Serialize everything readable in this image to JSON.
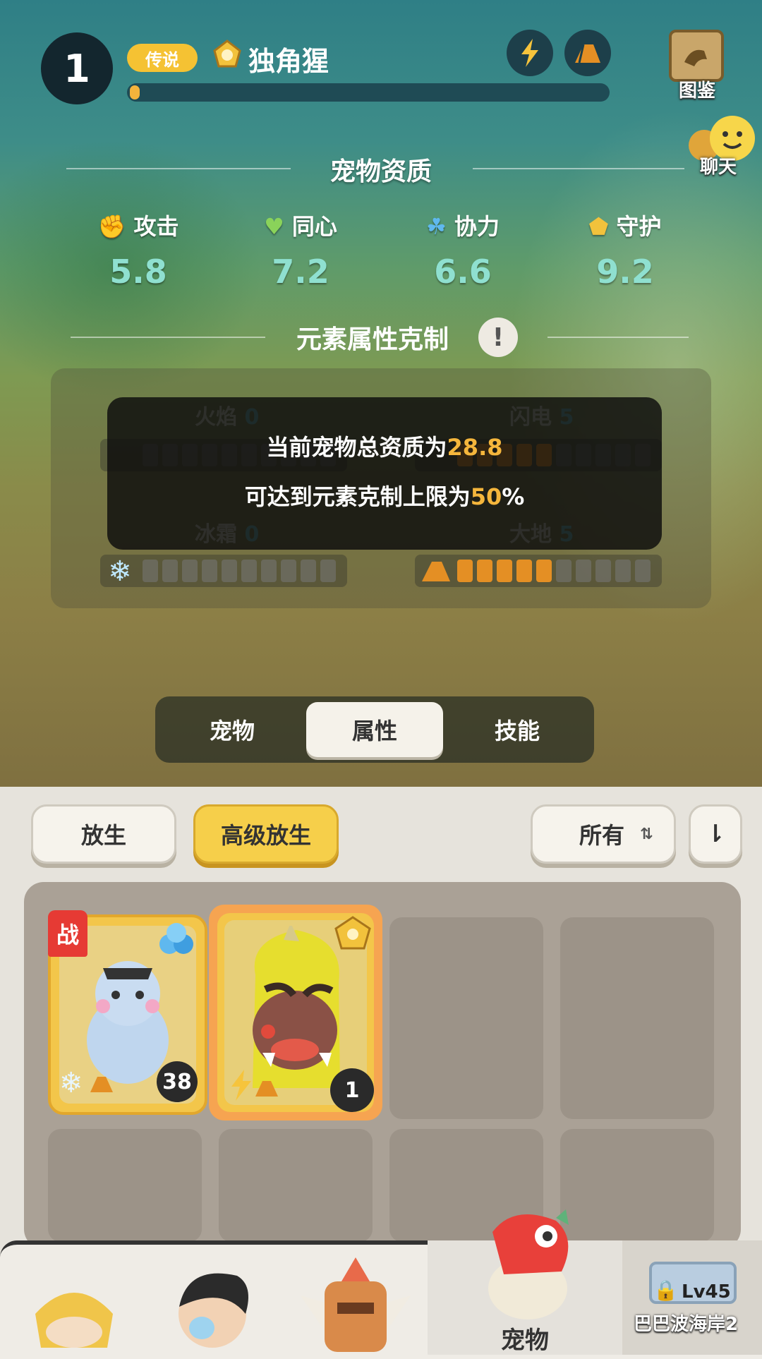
{
  "header": {
    "level": "1",
    "rarity": "传说",
    "pet_name": "独角猩",
    "xp_progress": 0.02,
    "codex_label": "图鉴",
    "chat_label": "聊天"
  },
  "aptitude": {
    "title": "宠物资质",
    "stats": [
      {
        "name": "攻击",
        "value": "5.8",
        "icon": "attack-icon"
      },
      {
        "name": "同心",
        "value": "7.2",
        "icon": "heart-icon"
      },
      {
        "name": "协力",
        "value": "6.6",
        "icon": "teamwork-icon"
      },
      {
        "name": "守护",
        "value": "9.2",
        "icon": "guard-icon"
      }
    ]
  },
  "element": {
    "title": "元素属性克制",
    "items": [
      {
        "name": "火焰",
        "value": "0",
        "filled": 0,
        "total": 10,
        "icon": "fire-icon"
      },
      {
        "name": "闪电",
        "value": "5",
        "filled": 5,
        "total": 10,
        "icon": "lightning-icon"
      },
      {
        "name": "冰霜",
        "value": "0",
        "filled": 0,
        "total": 10,
        "icon": "snowflake-icon"
      },
      {
        "name": "大地",
        "value": "5",
        "filled": 5,
        "total": 10,
        "icon": "earth-icon"
      }
    ]
  },
  "tooltip": {
    "line1_prefix": "当前宠物总资质为",
    "line1_value": "28.8",
    "line2_prefix": "可达到元素克制上限为",
    "line2_value": "50",
    "line2_suffix": "%"
  },
  "tabs": {
    "items": [
      "宠物",
      "属性",
      "技能"
    ],
    "active": "属性"
  },
  "actions": {
    "release": "放生",
    "advanced_release": "高级放生",
    "filter": "所有"
  },
  "pets": [
    {
      "level": "38",
      "battle_tag": "战",
      "name_hidden": true
    },
    {
      "level": "1"
    }
  ],
  "bottom_nav": {
    "pet_label": "宠物",
    "locked_level": "Lv45",
    "locked_area": "巴巴波海岸2"
  },
  "colors": {
    "gold": "#f5c233",
    "element_fill": "#e48f24",
    "highlight": "#f5b63c"
  }
}
